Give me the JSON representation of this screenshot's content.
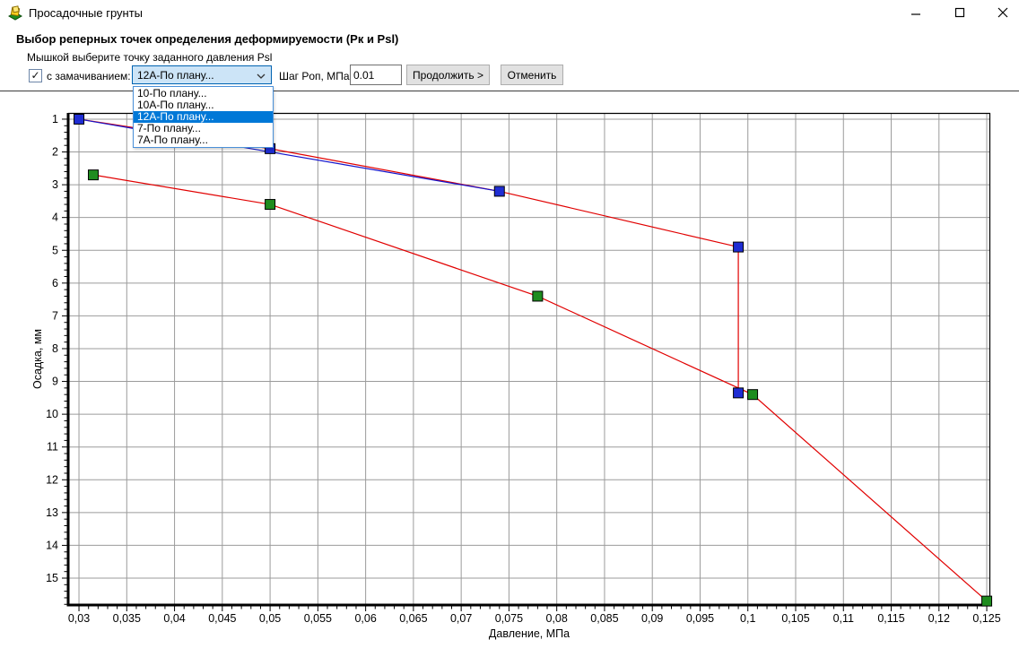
{
  "window": {
    "title": "Просадочные грунты",
    "icon": "soil-app-icon"
  },
  "header": {
    "title": "Выбор реперных точек определения деформируемости  (Рк и Psl)",
    "subtitle": "Мышкой выберите точку заданного давления Psl"
  },
  "toolbar": {
    "soak_checkbox": {
      "checked": true,
      "checkmark": "✓",
      "label": "с замачиванием:"
    },
    "test_select": {
      "value": "12А-По плану...",
      "options": [
        "10-По плану...",
        "10А-По плану...",
        "12А-По плану...",
        "7-По плану...",
        "7А-По плану..."
      ],
      "highlighted_index": 2,
      "highlight_color": "#0078d7"
    },
    "step_label": "Шаг Pоп, МПа:",
    "step_value": "0.01",
    "continue_button": "Продолжить >",
    "cancel_button": "Отменить"
  },
  "chart_data": {
    "type": "line",
    "xlabel": "Давление, МПа",
    "ylabel": "Осадка, мм",
    "x_axis": {
      "tick_values": [
        0.03,
        0.035,
        0.04,
        0.045,
        0.05,
        0.055,
        0.06,
        0.065,
        0.07,
        0.075,
        0.08,
        0.085,
        0.09,
        0.095,
        0.1,
        0.105,
        0.11,
        0.115,
        0.12,
        0.125
      ],
      "tick_labels": [
        "0,03",
        "0,035",
        "0,04",
        "0,045",
        "0,05",
        "0,055",
        "0,06",
        "0,065",
        "0,07",
        "0,075",
        "0,08",
        "0,085",
        "0,09",
        "0,095",
        "0,1",
        "0,105",
        "0,11",
        "0,115",
        "0,12",
        "0,125"
      ],
      "minor_step": 0.001,
      "lim": [
        0.02887,
        0.12537
      ]
    },
    "y_axis": {
      "tick_values": [
        1,
        2,
        3,
        4,
        5,
        6,
        7,
        8,
        9,
        10,
        11,
        12,
        13,
        14,
        15
      ],
      "tick_labels": [
        "1",
        "2",
        "3",
        "4",
        "5",
        "6",
        "7",
        "8",
        "9",
        "10",
        "11",
        "12",
        "13",
        "14",
        "15"
      ],
      "minor_step": 0.2,
      "lim": [
        0.81,
        15.82
      ],
      "inverted": true
    },
    "grid": true,
    "grid_color": "#9b9b9b",
    "series": [
      {
        "id": "upper-curve-no-soak",
        "line_color": "#e10000",
        "marker": "square",
        "marker_color": "#1f2dd4",
        "points": [
          [
            0.03,
            1.0
          ],
          [
            0.05,
            1.9
          ],
          [
            0.074,
            3.2
          ],
          [
            0.099,
            4.9
          ],
          [
            0.099,
            9.35
          ]
        ]
      },
      {
        "id": "lower-curve-soaked",
        "line_color": "#e10000",
        "marker": "square",
        "marker_color": "#1f8c1f",
        "points": [
          [
            0.0315,
            2.7
          ],
          [
            0.05,
            3.6
          ],
          [
            0.078,
            6.4
          ],
          [
            0.1005,
            9.4
          ],
          [
            0.125,
            15.7
          ]
        ]
      },
      {
        "id": "secant-line",
        "line_color": "#1414cc",
        "marker": "none",
        "points": [
          [
            0.03,
            1.0
          ],
          [
            0.074,
            3.2
          ]
        ]
      }
    ]
  }
}
